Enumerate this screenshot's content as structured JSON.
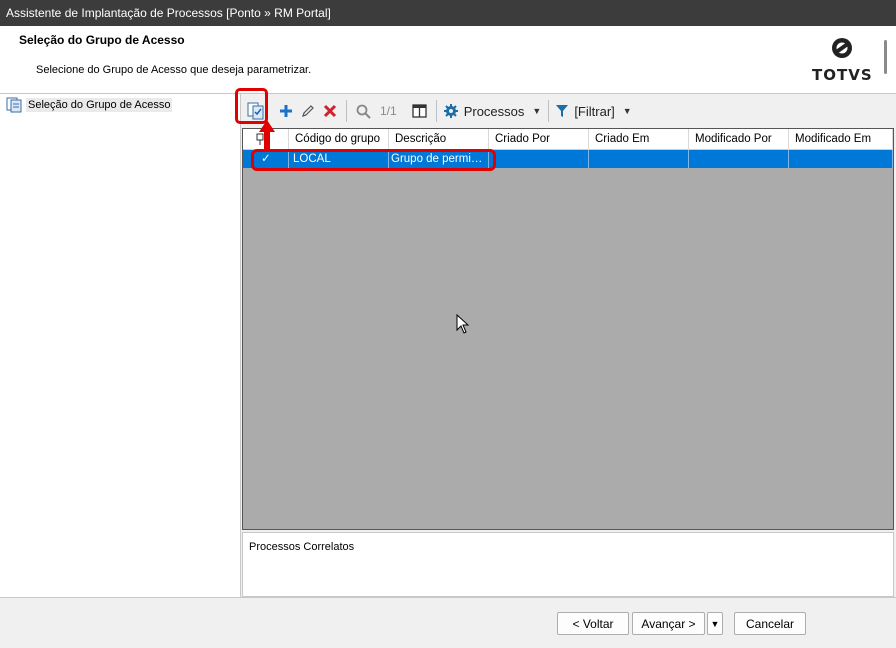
{
  "window": {
    "title": "Assistente de Implantação de Processos [Ponto » RM Portal]"
  },
  "header": {
    "title": "Seleção do Grupo de Acesso",
    "subtitle": "Selecione do Grupo de Acesso que deseja parametrizar.",
    "logo_text": "TOTVS"
  },
  "tree": {
    "items": [
      {
        "label": "Seleção do Grupo de Acesso"
      }
    ]
  },
  "toolbar": {
    "pager": "1/1",
    "processos_label": "Processos",
    "filter_label": "[Filtrar]"
  },
  "grid": {
    "columns": [
      "",
      "Código do grupo",
      "Descrição",
      "Criado Por",
      "Criado Em",
      "Modificado Por",
      "Modificado Em"
    ],
    "rows": [
      {
        "checked": "✓",
        "codigo": "LOCAL",
        "descricao": "Grupo de permiss...",
        "criado_por": "",
        "criado_em": "",
        "modificado_por": "",
        "modificado_em": ""
      }
    ]
  },
  "related": {
    "title": "Processos Correlatos"
  },
  "footer": {
    "back_label": "< Voltar",
    "next_label": "Avançar >",
    "cancel_label": "Cancelar"
  },
  "colors": {
    "accent": "#0078d7",
    "annotation": "#e00000",
    "titlebar": "#3c3c3c"
  }
}
